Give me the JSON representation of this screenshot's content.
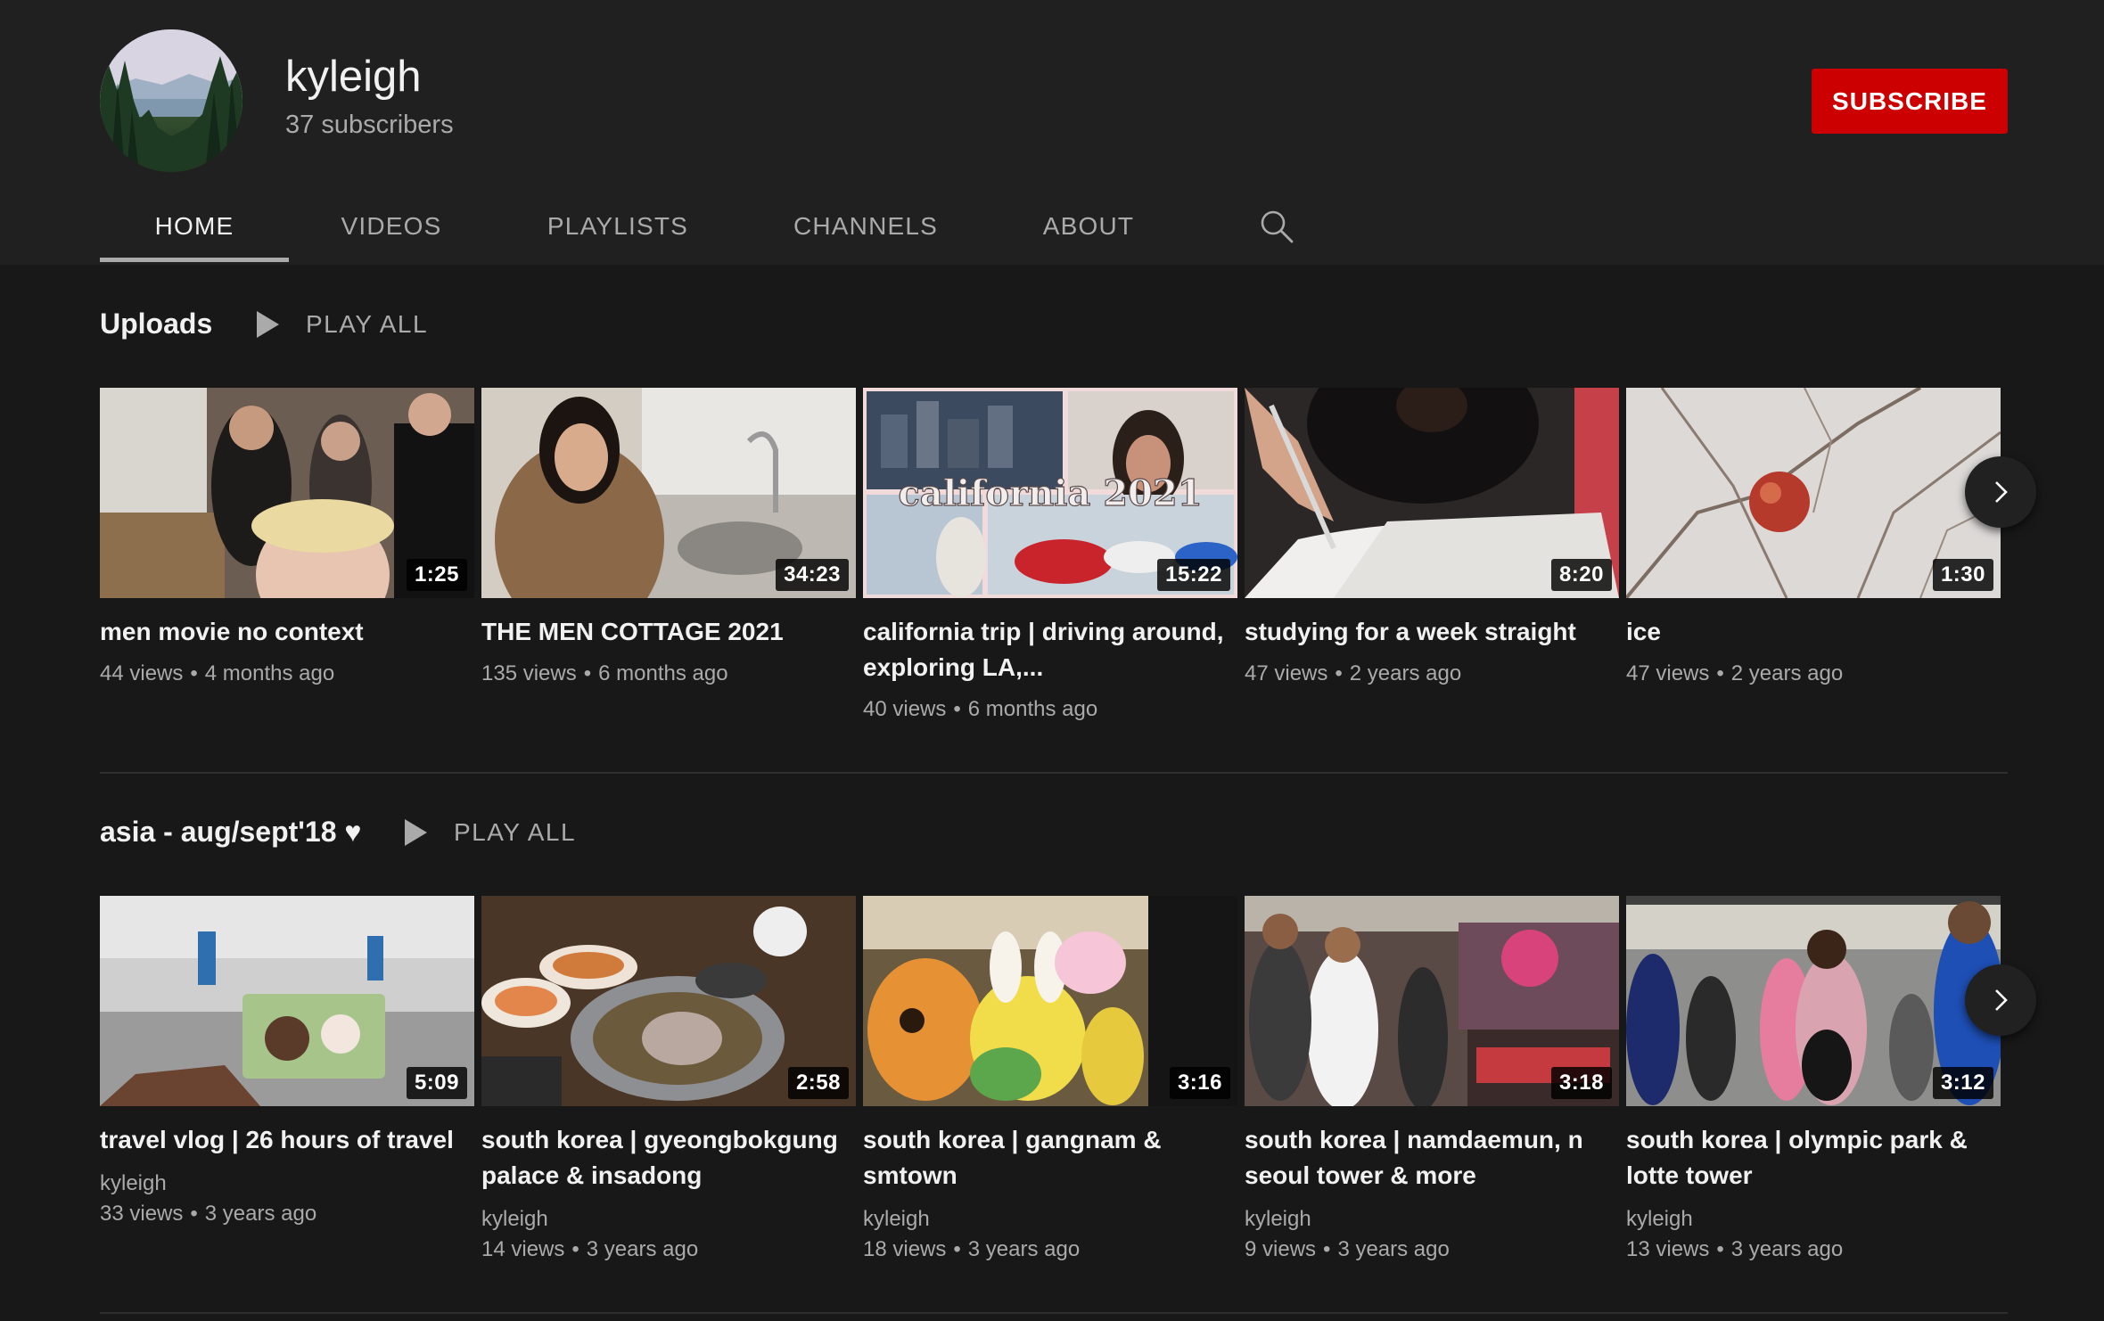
{
  "channel": {
    "name": "kyleigh",
    "subscribers": "37 subscribers",
    "subscribe_label": "SUBSCRIBE"
  },
  "tabs": [
    {
      "label": "HOME",
      "active": true
    },
    {
      "label": "VIDEOS",
      "active": false
    },
    {
      "label": "PLAYLISTS",
      "active": false
    },
    {
      "label": "CHANNELS",
      "active": false
    },
    {
      "label": "ABOUT",
      "active": false
    }
  ],
  "shelves": [
    {
      "title": "Uploads",
      "play_all": "PLAY ALL",
      "videos": [
        {
          "title": "men movie no context",
          "views": "44 views",
          "age": "4 months ago",
          "duration": "1:25"
        },
        {
          "title": "THE MEN COTTAGE 2021",
          "views": "135 views",
          "age": "6 months ago",
          "duration": "34:23"
        },
        {
          "title": "california trip | driving around, exploring LA,...",
          "views": "40 views",
          "age": "6 months ago",
          "duration": "15:22",
          "overlay_text": "california 2021"
        },
        {
          "title": "studying for a week straight",
          "views": "47 views",
          "age": "2 years ago",
          "duration": "8:20"
        },
        {
          "title": "ice",
          "views": "47 views",
          "age": "2 years ago",
          "duration": "1:30"
        }
      ]
    },
    {
      "title": "asia - aug/sept'18 ♥",
      "play_all": "PLAY ALL",
      "videos": [
        {
          "title": "travel vlog | 26 hours of travel",
          "author": "kyleigh",
          "views": "33 views",
          "age": "3 years ago",
          "duration": "5:09"
        },
        {
          "title": "south korea | gyeongbokgung palace & insadong",
          "author": "kyleigh",
          "views": "14 views",
          "age": "3 years ago",
          "duration": "2:58"
        },
        {
          "title": "south korea | gangnam & smtown",
          "author": "kyleigh",
          "views": "18 views",
          "age": "3 years ago",
          "duration": "3:16"
        },
        {
          "title": "south korea | namdaemun, n seoul tower & more",
          "author": "kyleigh",
          "views": "9 views",
          "age": "3 years ago",
          "duration": "3:18"
        },
        {
          "title": "south korea | olympic park & lotte tower",
          "author": "kyleigh",
          "views": "13 views",
          "age": "3 years ago",
          "duration": "3:12"
        }
      ]
    }
  ],
  "meta_separator": "•",
  "colors": {
    "background": "#181818",
    "header_bg": "#202020",
    "subscribe_red": "#cc0000",
    "secondary_text": "#aaaaaa"
  },
  "icons": [
    "search-icon",
    "play-icon",
    "chevron-right-icon"
  ]
}
